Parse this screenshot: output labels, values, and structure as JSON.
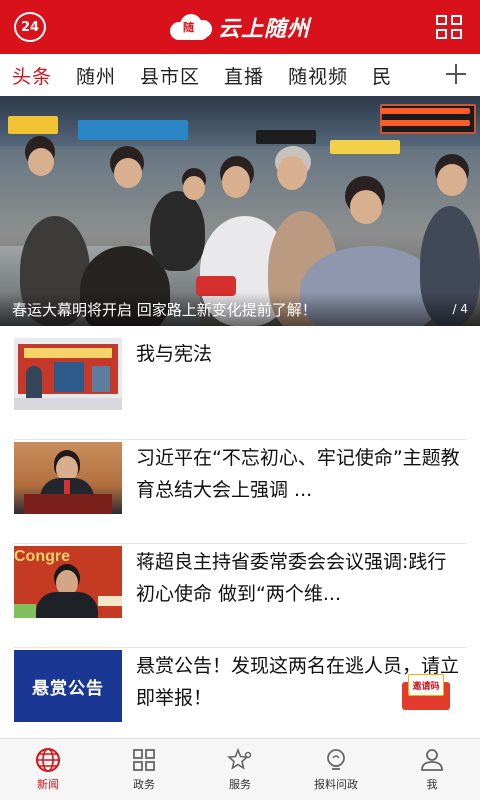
{
  "header": {
    "badge": "24",
    "title": "云上随州",
    "logo_mark": "随"
  },
  "tabs": [
    {
      "label": "头条",
      "active": true
    },
    {
      "label": "随州",
      "active": false
    },
    {
      "label": "县市区",
      "active": false
    },
    {
      "label": "直播",
      "active": false
    },
    {
      "label": "随视频",
      "active": false
    },
    {
      "label": "民",
      "active": false
    }
  ],
  "banner": {
    "caption": "春运大幕明将开启 回家路上新变化提前了解！",
    "index": "/ 4"
  },
  "news": [
    {
      "title": "我与宪法",
      "thumb": "constitution-thumbnail"
    },
    {
      "title": "习近平在“不忘初心、牢记使命”主题教育总结大会上强调 ...",
      "thumb": "speech-thumbnail"
    },
    {
      "title": "蒋超良主持省委常委会会议强调:践行初心使命 做到“两个维...",
      "thumb": "meeting-thumbnail"
    },
    {
      "title": "悬赏公告！发现这两名在逃人员，请立即举报！",
      "thumb": "notice-thumbnail",
      "thumb_text": "悬赏公告"
    }
  ],
  "invite": {
    "label": "邀请码"
  },
  "bottom_nav": [
    {
      "label": "新闻",
      "icon": "globe-icon",
      "active": true
    },
    {
      "label": "政务",
      "icon": "grid-icon",
      "active": false
    },
    {
      "label": "服务",
      "icon": "star-icon",
      "active": false
    },
    {
      "label": "报料问政",
      "icon": "bulb-icon",
      "active": false
    },
    {
      "label": "我",
      "icon": "user-icon",
      "active": false
    }
  ],
  "colors": {
    "brand": "#d9111b",
    "notice_blue": "#1a3794"
  }
}
